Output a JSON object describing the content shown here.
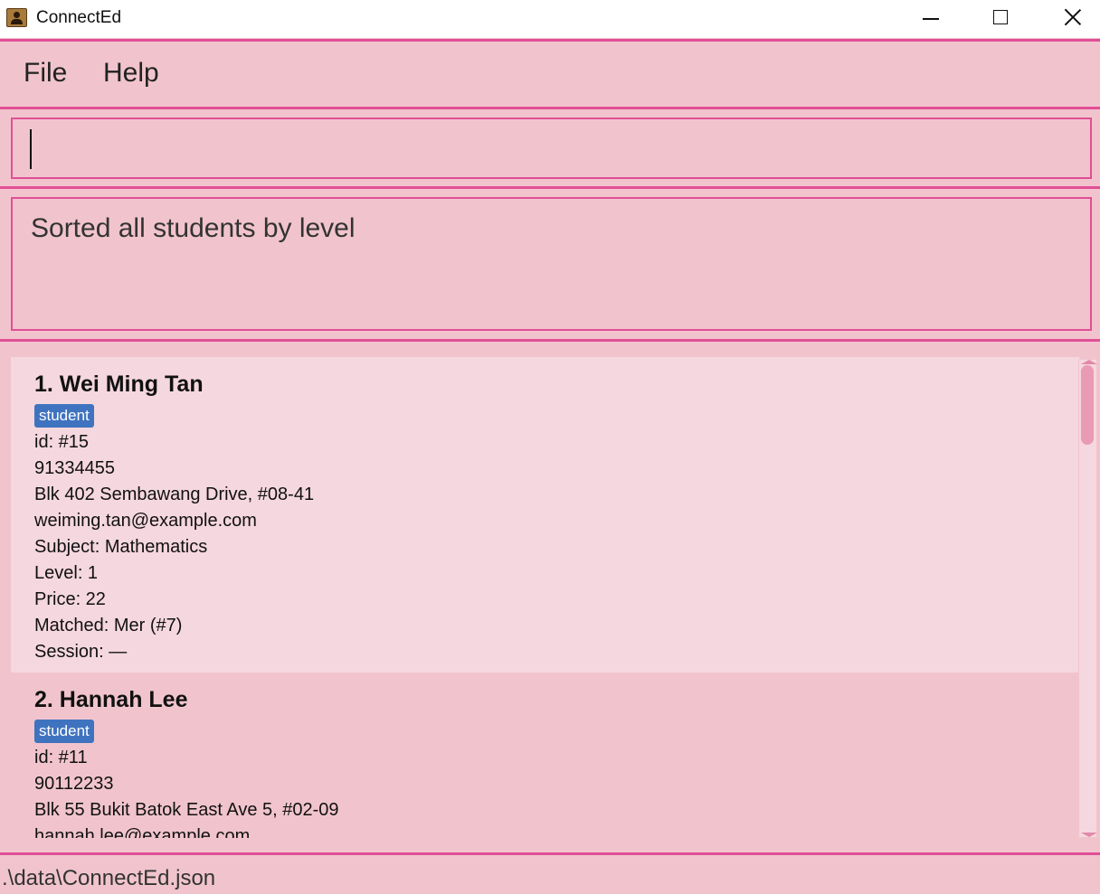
{
  "window": {
    "title": "ConnectEd",
    "icon": "contacts-book-icon",
    "controls": [
      "minimize-icon",
      "maximize-icon",
      "close-icon"
    ]
  },
  "menu": {
    "file_label": "File",
    "help_label": "Help"
  },
  "command_box": {
    "value": ""
  },
  "result": {
    "message": "Sorted all students by level"
  },
  "list": {
    "persons": [
      {
        "name": "1. Wei Ming Tan",
        "tag": "student",
        "id": "id: #15",
        "phone": "91334455",
        "address": "Blk 402 Sembawang Drive, #08-41",
        "email": "weiming.tan@example.com",
        "subject": "Subject: Mathematics",
        "level": "Level: 1",
        "price": "Price: 22",
        "matched": "Matched: Mer (#7)",
        "session": "Session: —"
      },
      {
        "name": "2. Hannah Lee",
        "tag": "student",
        "id": "id: #11",
        "phone": "90112233",
        "address": "Blk 55 Bukit Batok East Ave 5, #02-09",
        "email": "hannah.lee@example.com"
      }
    ]
  },
  "status": {
    "file_path": ".\\data\\ConnectEd.json"
  },
  "colors": {
    "background": "#f1c4cd",
    "accent": "#e04f97",
    "selected_card": "#f5d7df",
    "tag": "#3f73bf"
  }
}
